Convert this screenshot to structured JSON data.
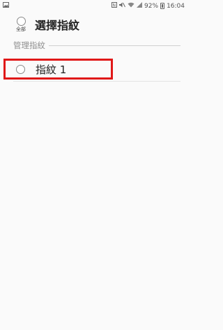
{
  "status_bar": {
    "battery": "92%",
    "time": "16:04",
    "icons": [
      "gallery-icon",
      "nfc-icon",
      "mute-icon",
      "wifi-icon",
      "signal-icon",
      "battery-icon"
    ]
  },
  "header": {
    "select_all_label": "全部",
    "title": "選擇指紋"
  },
  "section": {
    "label": "管理指紋"
  },
  "fingerprints": [
    {
      "label": "指紋 1"
    }
  ],
  "colors": {
    "highlight": "#e01818",
    "background": "#fafafa"
  }
}
